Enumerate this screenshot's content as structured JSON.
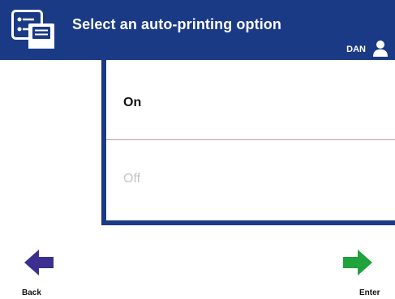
{
  "header": {
    "title": "Select an auto-printing option",
    "user": "DAN",
    "icons": {
      "app": "printer-settings-icon",
      "user": "user-icon"
    },
    "background_color": "#1b3a86"
  },
  "options": [
    {
      "label": "On",
      "state": "enabled"
    },
    {
      "label": "Off",
      "state": "disabled"
    }
  ],
  "navigation": {
    "back_label": "Back",
    "enter_label": "Enter",
    "back_icon": "arrow-left-icon",
    "enter_icon": "arrow-right-icon",
    "back_color": "#3b2f8f",
    "enter_color": "#1fa33a"
  }
}
